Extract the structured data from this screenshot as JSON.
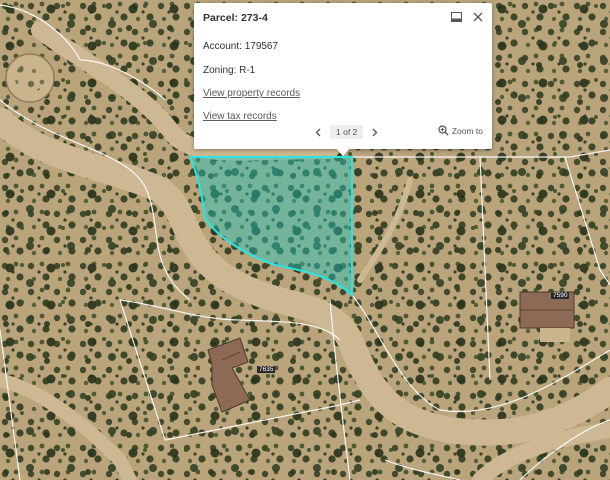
{
  "popup": {
    "title": "Parcel: 273-4",
    "account": "Account: 179567",
    "zoning": "Zoning: R-1",
    "link_property": "View property records",
    "link_tax": "View tax records",
    "pager_text": "1 of 2",
    "zoom_label": "Zoom to",
    "icons": {
      "dock": "dock-icon",
      "close": "close-icon",
      "prev": "chevron-left-icon",
      "next": "chevron-right-icon",
      "zoom": "zoom-to-icon"
    }
  },
  "map": {
    "house_labels": [
      "7590",
      "7635"
    ],
    "colors": {
      "ground": "#b9a47c",
      "road": "#cbb691",
      "parcel_fill": "#22c7c0",
      "parcel_outline": "#2fe3e0",
      "parcel_lines": "#ffffff",
      "roof": "#8c6a55"
    }
  }
}
